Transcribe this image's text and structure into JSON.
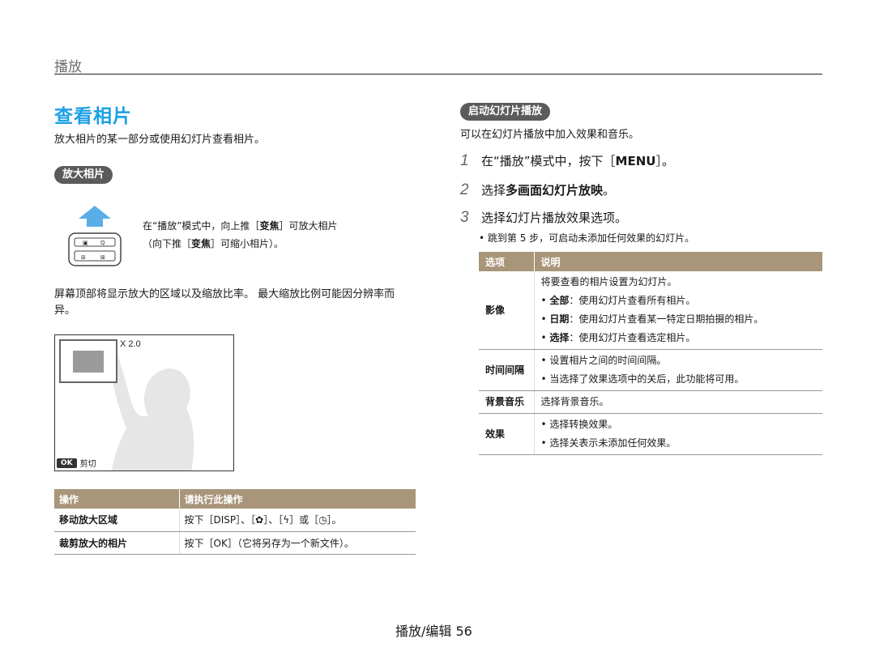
{
  "header": {
    "section": "播放"
  },
  "left": {
    "title": "查看相片",
    "intro": "放大相片的某一部分或使用幻灯片查看相片。",
    "zoom_pill": "放大相片",
    "zoom_desc_1a": "在“播放”模式中，向上推［",
    "zoom_desc_1b": "变焦",
    "zoom_desc_1c": "］可放大相片",
    "zoom_desc_2a": "（向下推［",
    "zoom_desc_2b": "变焦",
    "zoom_desc_2c": "］可缩小相片）。",
    "screen_note": "屏幕顶部将显示放大的区域以及缩放比率。 最大缩放比例可能因分辨率而异。",
    "preview": {
      "ratio": "X 2.0",
      "ok": "OK",
      "crop": "剪切"
    },
    "ops_table": {
      "headers": [
        "操作",
        "请执行此操作"
      ],
      "rows": [
        {
          "op": "移动放大区域",
          "action": "按下［DISP］、［✿］、［ϟ］或［◷］。"
        },
        {
          "op": "裁剪放大的相片",
          "action": "按下［OK］（它将另存为一个新文件）。"
        }
      ]
    }
  },
  "right": {
    "slide_pill": "启动幻灯片播放",
    "intro": "可以在幻灯片播放中加入效果和音乐。",
    "steps": [
      {
        "num": "1",
        "pre": "在“播放”模式中，按下［",
        "bold": "MENU",
        "post": "］。"
      },
      {
        "num": "2",
        "pre": "选择",
        "bold": "多画面幻灯片放映",
        "post": "。"
      },
      {
        "num": "3",
        "pre": "选择幻灯片播放效果选项。",
        "bold": "",
        "post": ""
      }
    ],
    "step_bullet": "•  跳到第 5 步，可启动未添加任何效果的幻灯片。",
    "options_table": {
      "headers": [
        "选项",
        "说明"
      ],
      "rows": [
        {
          "opt": "影像",
          "lines": [
            {
              "plain": "将要查看的相片设置为幻灯片。"
            },
            {
              "bullet": true,
              "bold": "全部",
              "rest": "：使用幻灯片查看所有相片。"
            },
            {
              "bullet": true,
              "bold": "日期",
              "rest": "：使用幻灯片查看某一特定日期拍摄的相片。"
            },
            {
              "bullet": true,
              "bold": "选择",
              "rest": "：使用幻灯片查看选定相片。"
            }
          ]
        },
        {
          "opt": "时间间隔",
          "lines": [
            {
              "bullet": true,
              "bold": "",
              "rest": "设置相片之间的时间间隔。"
            },
            {
              "bullet": true,
              "bold": "",
              "rest": "当选择了效果选项中的关后，此功能将可用。"
            }
          ]
        },
        {
          "opt": "背景音乐",
          "lines": [
            {
              "plain": "选择背景音乐。"
            }
          ]
        },
        {
          "opt": "效果",
          "lines": [
            {
              "bullet": true,
              "bold": "",
              "rest": "选择转换效果。"
            },
            {
              "bullet": true,
              "bold": "",
              "rest": "选择关表示未添加任何效果。"
            }
          ]
        }
      ]
    }
  },
  "footer": {
    "page": "播放/编辑 56"
  }
}
